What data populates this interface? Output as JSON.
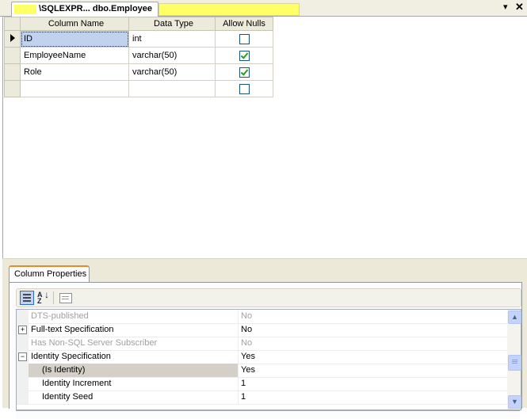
{
  "document_tab": {
    "title": "\\SQLEXPR... dbo.Employee"
  },
  "tab_controls": {
    "dropdown_glyph": "▾",
    "close_glyph": "✕"
  },
  "designer_grid": {
    "headers": [
      "Column Name",
      "Data Type",
      "Allow Nulls"
    ],
    "rows": [
      {
        "name": "ID",
        "type": "int",
        "allow_nulls": false,
        "current": true
      },
      {
        "name": "EmployeeName",
        "type": "varchar(50)",
        "allow_nulls": true
      },
      {
        "name": "Role",
        "type": "varchar(50)",
        "allow_nulls": true
      },
      {
        "name": "",
        "type": "",
        "allow_nulls": false
      }
    ]
  },
  "column_properties": {
    "tab_label": "Column Properties",
    "toolbar": {
      "categorized_icon": "categorized-icon",
      "alphabetical_icon": "sort-az-icon",
      "property_pages_icon": "property-pages-icon"
    },
    "properties": [
      {
        "name": "DTS-published",
        "value": "No",
        "disabled": true
      },
      {
        "name": "Full-text Specification",
        "value": "No",
        "expander": "+"
      },
      {
        "name": "Has Non-SQL Server Subscriber",
        "value": "No",
        "disabled": true
      },
      {
        "name": "Identity Specification",
        "value": "Yes",
        "expander": "−"
      },
      {
        "name": "(Is Identity)",
        "value": "Yes",
        "indent": true,
        "highlighted": true
      },
      {
        "name": "Identity Increment",
        "value": "1",
        "indent": true
      },
      {
        "name": "Identity Seed",
        "value": "1",
        "indent": true
      }
    ]
  },
  "colors": {
    "highlight_yellow": "#ffff66",
    "selection_blue": "#c1d2ee",
    "check_green": "#21a121",
    "panel_bg": "#ece9d8"
  }
}
